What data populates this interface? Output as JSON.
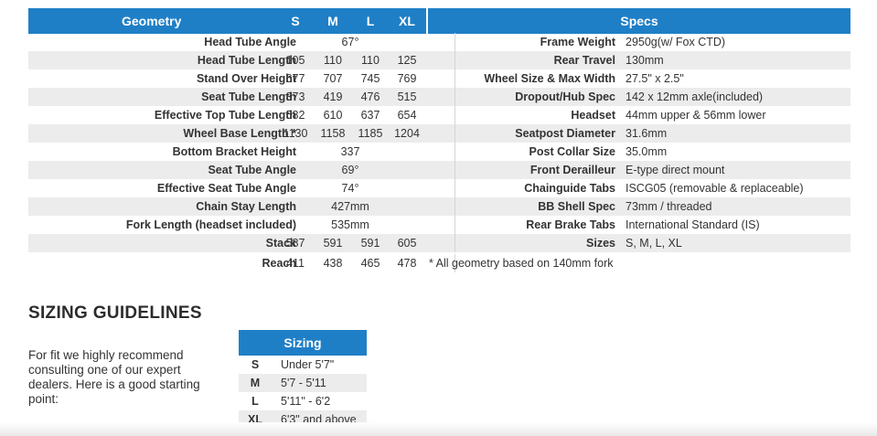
{
  "geometry_header": {
    "title": "Geometry",
    "sizes": [
      "S",
      "M",
      "L",
      "XL"
    ]
  },
  "specs_header": {
    "title": "Specs"
  },
  "rows": [
    {
      "label": "Head Tube Angle",
      "merged": "67°",
      "spec_label": "Frame Weight",
      "spec_value": "2950g(w/ Fox CTD)"
    },
    {
      "label": "Head Tube Length",
      "values": [
        "105",
        "110",
        "110",
        "125"
      ],
      "spec_label": "Rear Travel",
      "spec_value": "130mm"
    },
    {
      "label": "Stand Over Height",
      "values": [
        "677",
        "707",
        "745",
        "769"
      ],
      "spec_label": "Wheel Size & Max Width",
      "spec_value": "27.5\" x 2.5\""
    },
    {
      "label": "Seat Tube Length",
      "values": [
        "373",
        "419",
        "476",
        "515"
      ],
      "spec_label": "Dropout/Hub Spec",
      "spec_value": "142 x 12mm axle(included)"
    },
    {
      "label": "Effective Top Tube Length",
      "values": [
        "582",
        "610",
        "637",
        "654"
      ],
      "spec_label": "Headset",
      "spec_value": "44mm upper & 56mm lower"
    },
    {
      "label": "Wheel Base Length *",
      "values": [
        "1130",
        "1158",
        "1185",
        "1204"
      ],
      "spec_label": "Seatpost Diameter",
      "spec_value": "31.6mm"
    },
    {
      "label": "Bottom Bracket Height",
      "merged": "337",
      "spec_label": "Post Collar Size",
      "spec_value": "35.0mm"
    },
    {
      "label": "Seat Tube Angle",
      "merged": "69°",
      "spec_label": "Front Derailleur",
      "spec_value": "E-type direct mount"
    },
    {
      "label": "Effective Seat Tube Angle",
      "merged": "74°",
      "spec_label": "Chainguide Tabs",
      "spec_value": "ISCG05 (removable & replaceable)"
    },
    {
      "label": "Chain Stay Length",
      "merged": "427mm",
      "spec_label": "BB Shell Spec",
      "spec_value": "73mm / threaded"
    },
    {
      "label": "Fork Length (headset included)",
      "merged": "535mm",
      "spec_label": "Rear Brake Tabs",
      "spec_value": "International Standard (IS)"
    },
    {
      "label": "Stack",
      "values": [
        "587",
        "591",
        "591",
        "605"
      ],
      "spec_label": "Sizes",
      "spec_value": "S, M, L, XL"
    },
    {
      "label": "Reach",
      "values": [
        "411",
        "438",
        "465",
        "478"
      ],
      "note": "* All geometry based on 140mm fork"
    }
  ],
  "sizing": {
    "title": "SIZING GUIDELINES",
    "text": "For fit we highly recommend consulting one of our expert dealers. Here is a good starting point:",
    "table_header": "Sizing",
    "rows": [
      {
        "size": "S",
        "range": "Under 5'7\""
      },
      {
        "size": "M",
        "range": "5'7 - 5'11"
      },
      {
        "size": "L",
        "range": "5'11\" - 6'2"
      },
      {
        "size": "XL",
        "range": "6'3\" and above"
      }
    ]
  }
}
